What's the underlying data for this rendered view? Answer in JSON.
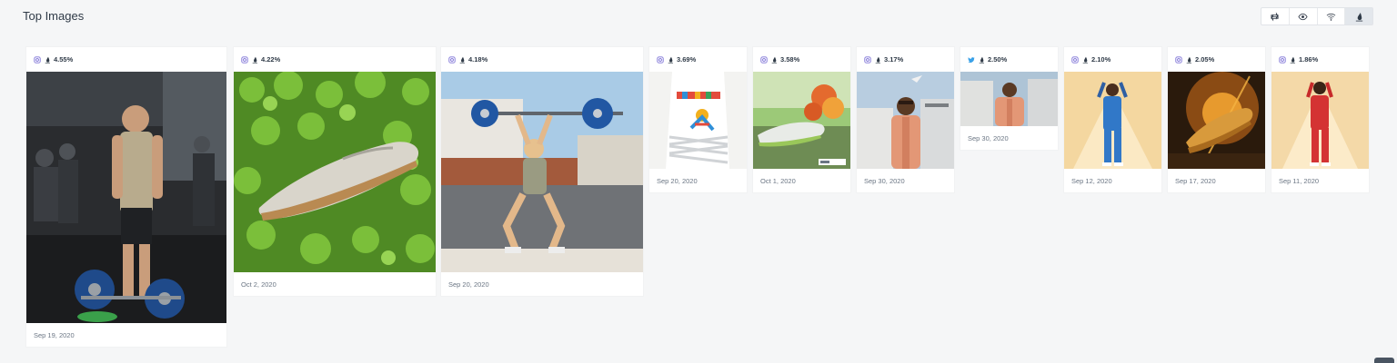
{
  "page": {
    "title": "Top Images"
  },
  "toolbar": {
    "buttons": [
      {
        "icon": "retweet-icon"
      },
      {
        "icon": "eye-icon"
      },
      {
        "icon": "wifi-icon"
      },
      {
        "icon": "engagement-drop-icon",
        "active": true
      }
    ]
  },
  "cards": [
    {
      "network": "instagram",
      "rate": "4.55%",
      "date": "Sep 19, 2020"
    },
    {
      "network": "instagram",
      "rate": "4.22%",
      "date": "Oct 2, 2020"
    },
    {
      "network": "instagram",
      "rate": "4.18%",
      "date": "Sep 20, 2020"
    },
    {
      "network": "instagram",
      "rate": "3.69%",
      "date": "Sep 20, 2020"
    },
    {
      "network": "instagram",
      "rate": "3.58%",
      "date": "Oct 1, 2020"
    },
    {
      "network": "instagram",
      "rate": "3.17%",
      "date": "Sep 30, 2020"
    },
    {
      "network": "twitter",
      "rate": "2.50%",
      "date": "Sep 30, 2020"
    },
    {
      "network": "instagram",
      "rate": "2.10%",
      "date": "Sep 12, 2020"
    },
    {
      "network": "instagram",
      "rate": "2.05%",
      "date": "Sep 17, 2020"
    },
    {
      "network": "instagram",
      "rate": "1.86%",
      "date": "Sep 11, 2020"
    }
  ],
  "colors": {
    "instagram": "#7a6fd6",
    "twitter": "#3aa1e8",
    "accent": "#2f3a47"
  }
}
